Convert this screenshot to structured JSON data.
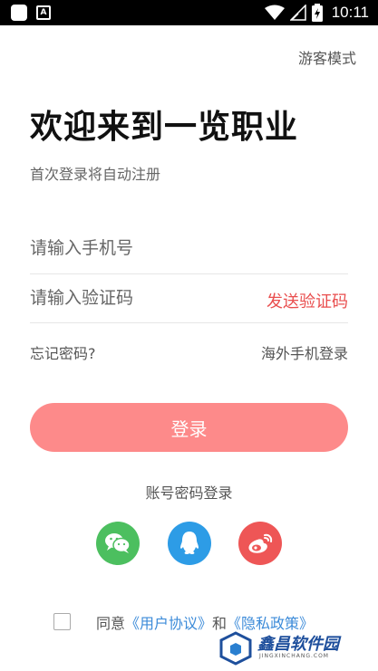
{
  "status_bar": {
    "time": "10:11"
  },
  "header": {
    "guest_mode": "游客模式"
  },
  "welcome": {
    "title": "欢迎来到一览职业",
    "subtitle": "首次登录将自动注册"
  },
  "form": {
    "phone_placeholder": "请输入手机号",
    "code_placeholder": "请输入验证码",
    "send_code": "发送验证码",
    "forgot_password": "忘记密码?",
    "overseas_login": "海外手机登录",
    "login_button": "登录"
  },
  "alt_login": {
    "label": "账号密码登录"
  },
  "social": [
    "wechat-icon",
    "qq-icon",
    "weibo-icon"
  ],
  "agreement": {
    "prefix": "同意",
    "user_agreement": "《用户协议》",
    "and": "和",
    "privacy_policy": "《隐私政策》"
  },
  "watermark": {
    "text": "鑫昌软件园",
    "sub": "JINGXINCHANG.COM"
  },
  "colors": {
    "accent": "#e94e4e",
    "login_button": "#fd8a8a",
    "link": "#3c8bd9",
    "wechat": "#4cbf5f",
    "qq": "#2d9ce6",
    "weibo": "#ee5656"
  }
}
